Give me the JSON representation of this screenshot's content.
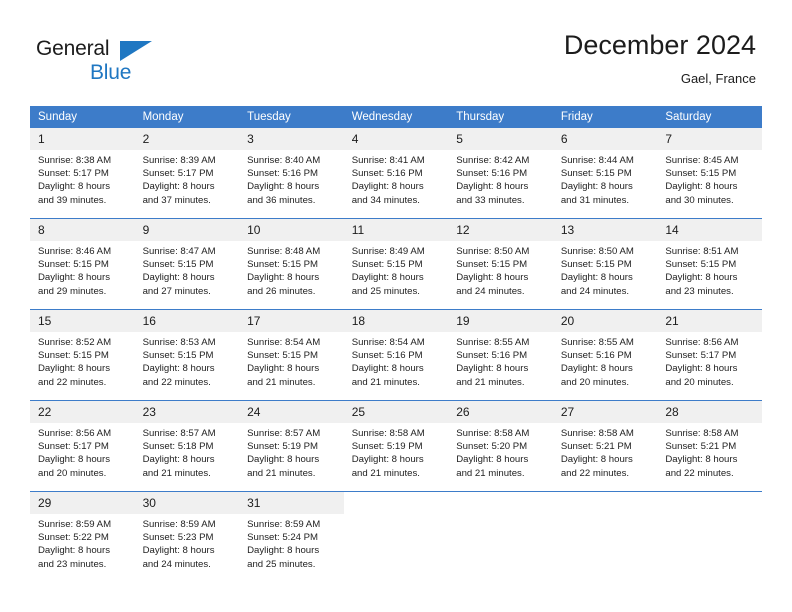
{
  "brand": {
    "name_top": "General",
    "name_bottom": "Blue",
    "triangle_color": "#1f77c2",
    "text_color": "#1c1c1c"
  },
  "header": {
    "title": "December 2024",
    "location": "Gael, France"
  },
  "theme": {
    "header_bg": "#3d7cc9",
    "header_text": "#ffffff",
    "daynum_bg": "#f0f0f0",
    "cell_bg": "#ffffff",
    "row_divider": "#3d7cc9",
    "body_text": "#222222"
  },
  "weekdays": [
    "Sunday",
    "Monday",
    "Tuesday",
    "Wednesday",
    "Thursday",
    "Friday",
    "Saturday"
  ],
  "weeks": [
    [
      {
        "day": "1",
        "sunrise": "Sunrise: 8:38 AM",
        "sunset": "Sunset: 5:17 PM",
        "daylight1": "Daylight: 8 hours",
        "daylight2": "and 39 minutes."
      },
      {
        "day": "2",
        "sunrise": "Sunrise: 8:39 AM",
        "sunset": "Sunset: 5:17 PM",
        "daylight1": "Daylight: 8 hours",
        "daylight2": "and 37 minutes."
      },
      {
        "day": "3",
        "sunrise": "Sunrise: 8:40 AM",
        "sunset": "Sunset: 5:16 PM",
        "daylight1": "Daylight: 8 hours",
        "daylight2": "and 36 minutes."
      },
      {
        "day": "4",
        "sunrise": "Sunrise: 8:41 AM",
        "sunset": "Sunset: 5:16 PM",
        "daylight1": "Daylight: 8 hours",
        "daylight2": "and 34 minutes."
      },
      {
        "day": "5",
        "sunrise": "Sunrise: 8:42 AM",
        "sunset": "Sunset: 5:16 PM",
        "daylight1": "Daylight: 8 hours",
        "daylight2": "and 33 minutes."
      },
      {
        "day": "6",
        "sunrise": "Sunrise: 8:44 AM",
        "sunset": "Sunset: 5:15 PM",
        "daylight1": "Daylight: 8 hours",
        "daylight2": "and 31 minutes."
      },
      {
        "day": "7",
        "sunrise": "Sunrise: 8:45 AM",
        "sunset": "Sunset: 5:15 PM",
        "daylight1": "Daylight: 8 hours",
        "daylight2": "and 30 minutes."
      }
    ],
    [
      {
        "day": "8",
        "sunrise": "Sunrise: 8:46 AM",
        "sunset": "Sunset: 5:15 PM",
        "daylight1": "Daylight: 8 hours",
        "daylight2": "and 29 minutes."
      },
      {
        "day": "9",
        "sunrise": "Sunrise: 8:47 AM",
        "sunset": "Sunset: 5:15 PM",
        "daylight1": "Daylight: 8 hours",
        "daylight2": "and 27 minutes."
      },
      {
        "day": "10",
        "sunrise": "Sunrise: 8:48 AM",
        "sunset": "Sunset: 5:15 PM",
        "daylight1": "Daylight: 8 hours",
        "daylight2": "and 26 minutes."
      },
      {
        "day": "11",
        "sunrise": "Sunrise: 8:49 AM",
        "sunset": "Sunset: 5:15 PM",
        "daylight1": "Daylight: 8 hours",
        "daylight2": "and 25 minutes."
      },
      {
        "day": "12",
        "sunrise": "Sunrise: 8:50 AM",
        "sunset": "Sunset: 5:15 PM",
        "daylight1": "Daylight: 8 hours",
        "daylight2": "and 24 minutes."
      },
      {
        "day": "13",
        "sunrise": "Sunrise: 8:50 AM",
        "sunset": "Sunset: 5:15 PM",
        "daylight1": "Daylight: 8 hours",
        "daylight2": "and 24 minutes."
      },
      {
        "day": "14",
        "sunrise": "Sunrise: 8:51 AM",
        "sunset": "Sunset: 5:15 PM",
        "daylight1": "Daylight: 8 hours",
        "daylight2": "and 23 minutes."
      }
    ],
    [
      {
        "day": "15",
        "sunrise": "Sunrise: 8:52 AM",
        "sunset": "Sunset: 5:15 PM",
        "daylight1": "Daylight: 8 hours",
        "daylight2": "and 22 minutes."
      },
      {
        "day": "16",
        "sunrise": "Sunrise: 8:53 AM",
        "sunset": "Sunset: 5:15 PM",
        "daylight1": "Daylight: 8 hours",
        "daylight2": "and 22 minutes."
      },
      {
        "day": "17",
        "sunrise": "Sunrise: 8:54 AM",
        "sunset": "Sunset: 5:15 PM",
        "daylight1": "Daylight: 8 hours",
        "daylight2": "and 21 minutes."
      },
      {
        "day": "18",
        "sunrise": "Sunrise: 8:54 AM",
        "sunset": "Sunset: 5:16 PM",
        "daylight1": "Daylight: 8 hours",
        "daylight2": "and 21 minutes."
      },
      {
        "day": "19",
        "sunrise": "Sunrise: 8:55 AM",
        "sunset": "Sunset: 5:16 PM",
        "daylight1": "Daylight: 8 hours",
        "daylight2": "and 21 minutes."
      },
      {
        "day": "20",
        "sunrise": "Sunrise: 8:55 AM",
        "sunset": "Sunset: 5:16 PM",
        "daylight1": "Daylight: 8 hours",
        "daylight2": "and 20 minutes."
      },
      {
        "day": "21",
        "sunrise": "Sunrise: 8:56 AM",
        "sunset": "Sunset: 5:17 PM",
        "daylight1": "Daylight: 8 hours",
        "daylight2": "and 20 minutes."
      }
    ],
    [
      {
        "day": "22",
        "sunrise": "Sunrise: 8:56 AM",
        "sunset": "Sunset: 5:17 PM",
        "daylight1": "Daylight: 8 hours",
        "daylight2": "and 20 minutes."
      },
      {
        "day": "23",
        "sunrise": "Sunrise: 8:57 AM",
        "sunset": "Sunset: 5:18 PM",
        "daylight1": "Daylight: 8 hours",
        "daylight2": "and 21 minutes."
      },
      {
        "day": "24",
        "sunrise": "Sunrise: 8:57 AM",
        "sunset": "Sunset: 5:19 PM",
        "daylight1": "Daylight: 8 hours",
        "daylight2": "and 21 minutes."
      },
      {
        "day": "25",
        "sunrise": "Sunrise: 8:58 AM",
        "sunset": "Sunset: 5:19 PM",
        "daylight1": "Daylight: 8 hours",
        "daylight2": "and 21 minutes."
      },
      {
        "day": "26",
        "sunrise": "Sunrise: 8:58 AM",
        "sunset": "Sunset: 5:20 PM",
        "daylight1": "Daylight: 8 hours",
        "daylight2": "and 21 minutes."
      },
      {
        "day": "27",
        "sunrise": "Sunrise: 8:58 AM",
        "sunset": "Sunset: 5:21 PM",
        "daylight1": "Daylight: 8 hours",
        "daylight2": "and 22 minutes."
      },
      {
        "day": "28",
        "sunrise": "Sunrise: 8:58 AM",
        "sunset": "Sunset: 5:21 PM",
        "daylight1": "Daylight: 8 hours",
        "daylight2": "and 22 minutes."
      }
    ],
    [
      {
        "day": "29",
        "sunrise": "Sunrise: 8:59 AM",
        "sunset": "Sunset: 5:22 PM",
        "daylight1": "Daylight: 8 hours",
        "daylight2": "and 23 minutes."
      },
      {
        "day": "30",
        "sunrise": "Sunrise: 8:59 AM",
        "sunset": "Sunset: 5:23 PM",
        "daylight1": "Daylight: 8 hours",
        "daylight2": "and 24 minutes."
      },
      {
        "day": "31",
        "sunrise": "Sunrise: 8:59 AM",
        "sunset": "Sunset: 5:24 PM",
        "daylight1": "Daylight: 8 hours",
        "daylight2": "and 25 minutes."
      },
      {
        "day": "",
        "sunrise": "",
        "sunset": "",
        "daylight1": "",
        "daylight2": ""
      },
      {
        "day": "",
        "sunrise": "",
        "sunset": "",
        "daylight1": "",
        "daylight2": ""
      },
      {
        "day": "",
        "sunrise": "",
        "sunset": "",
        "daylight1": "",
        "daylight2": ""
      },
      {
        "day": "",
        "sunrise": "",
        "sunset": "",
        "daylight1": "",
        "daylight2": ""
      }
    ]
  ]
}
